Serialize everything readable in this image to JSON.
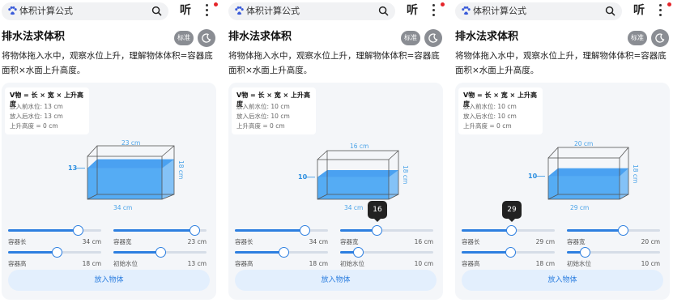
{
  "search": {
    "placeholder": "体积计算公式"
  },
  "header": {
    "listen_label": "听"
  },
  "article": {
    "title": "排水法求体积",
    "standard_button": "标准",
    "description": "将物体拖入水中，观察水位上升，理解物体体积=容器底面积×水面上升高度。"
  },
  "formula": {
    "main": "V物 = 长 × 宽 × 上升高度"
  },
  "colors": {
    "accent": "#2d7fe0",
    "water": "#3f9bf0",
    "track": "#d6dde7"
  },
  "icons": [
    "paw-logo-icon",
    "search-icon",
    "more-icon",
    "moon-icon"
  ],
  "panels": [
    {
      "before": "放入前水位: 13 cm",
      "after": "放入后水位: 13 cm",
      "rise": "上升高度 = 0 cm",
      "top_dim": "23 cm",
      "bottom_dim": "34 cm",
      "right_dim": "18 cm",
      "level": "13",
      "sliders": [
        {
          "label": "容器长",
          "value": "34 cm",
          "fraction": 0.75
        },
        {
          "label": "容器宽",
          "value": "23 cm",
          "fraction": 0.87
        },
        {
          "label": "容器高",
          "value": "18 cm",
          "fraction": 0.52
        },
        {
          "label": "初始水位",
          "value": "13 cm",
          "fraction": 0.5
        }
      ],
      "tooltip": null,
      "button": "放入物体"
    },
    {
      "before": "放入前水位: 10 cm",
      "after": "放入后水位: 10 cm",
      "rise": "上升高度 = 0 cm",
      "top_dim": "16 cm",
      "bottom_dim": "34 cm",
      "right_dim": "18 cm",
      "level": "10",
      "sliders": [
        {
          "label": "容器长",
          "value": "34 cm",
          "fraction": 0.75
        },
        {
          "label": "容器宽",
          "value": "16 cm",
          "fraction": 0.39
        },
        {
          "label": "容器高",
          "value": "18 cm",
          "fraction": 0.52
        },
        {
          "label": "初始水位",
          "value": "10 cm",
          "fraction": 0.19
        }
      ],
      "tooltip": {
        "slider": 1,
        "text": "16"
      },
      "button": "放入物体"
    },
    {
      "before": "放入前水位: 10 cm",
      "after": "放入后水位: 10 cm",
      "rise": "上升高度 = 0 cm",
      "top_dim": "20 cm",
      "bottom_dim": "29 cm",
      "right_dim": "18 cm",
      "level": "10",
      "sliders": [
        {
          "label": "容器长",
          "value": "29 cm",
          "fraction": 0.53
        },
        {
          "label": "容器宽",
          "value": "20 cm",
          "fraction": 0.6
        },
        {
          "label": "容器高",
          "value": "18 cm",
          "fraction": 0.52
        },
        {
          "label": "初始水位",
          "value": "10 cm",
          "fraction": 0.19
        }
      ],
      "tooltip": {
        "slider": 0,
        "text": "29"
      },
      "button": "放入物体"
    }
  ]
}
